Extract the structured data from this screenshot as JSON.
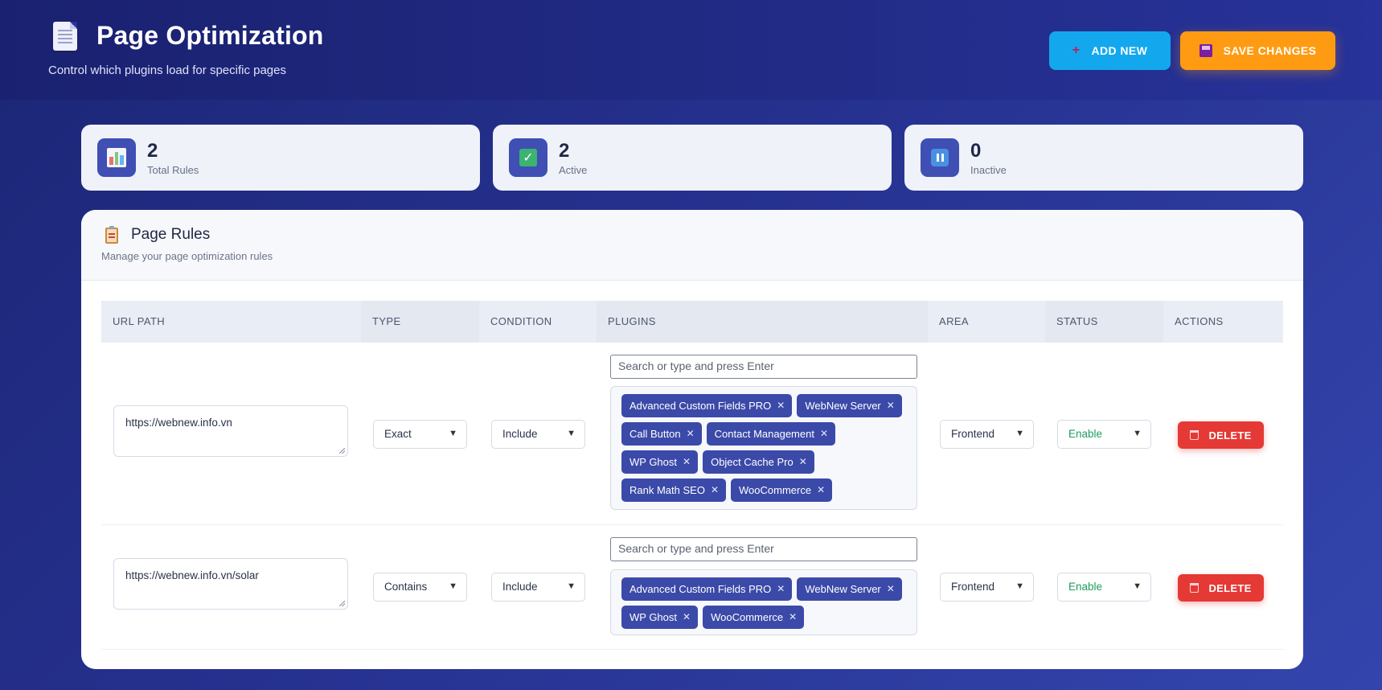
{
  "header": {
    "title": "Page Optimization",
    "subtitle": "Control which plugins load for specific pages",
    "add_label": "ADD NEW",
    "save_label": "SAVE CHANGES"
  },
  "stats": [
    {
      "value": "2",
      "label": "Total Rules",
      "icon": "bar-chart-icon"
    },
    {
      "value": "2",
      "label": "Active",
      "icon": "check-icon"
    },
    {
      "value": "0",
      "label": "Inactive",
      "icon": "pause-icon"
    }
  ],
  "panel": {
    "title": "Page Rules",
    "subtitle": "Manage your page optimization rules"
  },
  "table": {
    "columns": [
      "URL PATH",
      "TYPE",
      "CONDITION",
      "PLUGINS",
      "AREA",
      "STATUS",
      "ACTIONS"
    ],
    "search_placeholder": "Search or type and press Enter",
    "delete_label": "DELETE",
    "rows": [
      {
        "url": "https://webnew.info.vn",
        "type": "Exact",
        "condition": "Include",
        "plugins": [
          "Advanced Custom Fields PRO",
          "WebNew Server",
          "Call Button",
          "Contact Management",
          "WP Ghost",
          "Object Cache Pro",
          "Rank Math SEO",
          "WooCommerce"
        ],
        "area": "Frontend",
        "status": "Enable"
      },
      {
        "url": "https://webnew.info.vn/solar",
        "type": "Contains",
        "condition": "Include",
        "plugins": [
          "Advanced Custom Fields PRO",
          "WebNew Server",
          "WP Ghost",
          "WooCommerce"
        ],
        "area": "Frontend",
        "status": "Enable"
      }
    ]
  },
  "colors": {
    "accent": "#3b4aa8",
    "add_button": "#13a8ee",
    "save_button": "#ff9b12",
    "delete_button": "#e53935",
    "enable_text": "#1e9e5e"
  }
}
